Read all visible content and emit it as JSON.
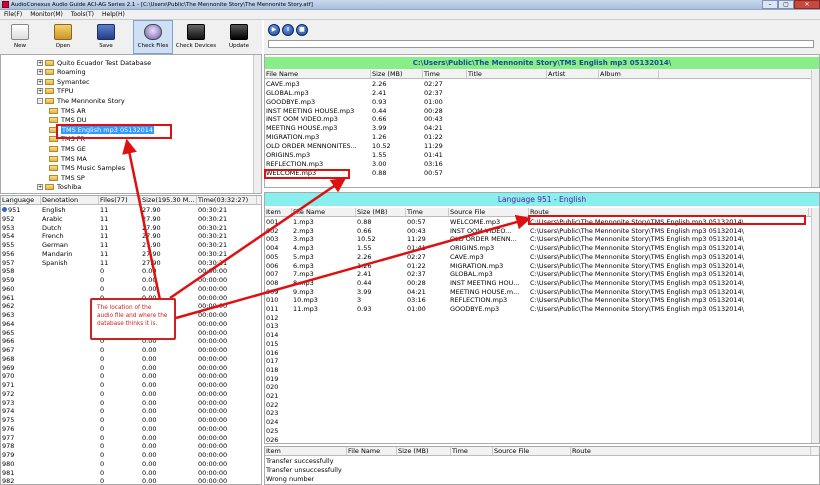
{
  "window": {
    "title": "AudioConexus Audio Guide ACI-AG Series 2.1 - [C:\\Users\\Public\\The Mennonite Story\\The Mennonite Story.atf]",
    "buttons": [
      "–",
      "▢",
      "✕"
    ]
  },
  "menu": [
    "File(F)",
    "Monitor(M)",
    "Tools(T)",
    "Help(H)"
  ],
  "toolbar": {
    "new": "New",
    "open": "Open",
    "save": "Save",
    "check_files": "Check Files",
    "check_devices": "Check Devices",
    "update": "Update"
  },
  "player": {
    "play": "▶",
    "pause": "II",
    "stop": "■"
  },
  "tree": {
    "nodes": [
      {
        "label": "Quito Ecuador Test Database",
        "exp": "+"
      },
      {
        "label": "Roaming",
        "exp": "+"
      },
      {
        "label": "Symantec",
        "exp": "+"
      },
      {
        "label": "TFPU",
        "exp": "+"
      },
      {
        "label": "The Mennonite Story",
        "exp": "-"
      },
      {
        "label": "TMS AR",
        "exp": ""
      },
      {
        "label": "TMS DU",
        "exp": ""
      },
      {
        "label": "TMS English mp3 05132014",
        "exp": ""
      },
      {
        "label": "TMS FR",
        "exp": ""
      },
      {
        "label": "TMS GE",
        "exp": ""
      },
      {
        "label": "TMS MA",
        "exp": ""
      },
      {
        "label": "TMS Music Samples",
        "exp": ""
      },
      {
        "label": "TMS SP",
        "exp": ""
      },
      {
        "label": "Toshiba",
        "exp": "+"
      }
    ]
  },
  "language_table": {
    "headers": [
      "Language",
      "Denotation",
      "Files(77)",
      "Size(195.30 M...",
      "Time(03:32:27)"
    ],
    "rows": [
      [
        "951",
        "English",
        "11",
        "27.90",
        "00:30:21"
      ],
      [
        "952",
        "Arabic",
        "11",
        "27.90",
        "00:30:21"
      ],
      [
        "953",
        "Dutch",
        "11",
        "27.90",
        "00:30:21"
      ],
      [
        "954",
        "French",
        "11",
        "27.90",
        "00:30:21"
      ],
      [
        "955",
        "German",
        "11",
        "27.90",
        "00:30:21"
      ],
      [
        "956",
        "Mandarin",
        "11",
        "27.90",
        "00:30:21"
      ],
      [
        "957",
        "Spanish",
        "11",
        "27.90",
        "00:30:21"
      ],
      [
        "958",
        "",
        "0",
        "0.00",
        "00:00:00"
      ],
      [
        "959",
        "",
        "0",
        "0.00",
        "00:00:00"
      ],
      [
        "960",
        "",
        "0",
        "0.00",
        "00:00:00"
      ],
      [
        "961",
        "",
        "0",
        "0.00",
        "00:00:00"
      ],
      [
        "962",
        "",
        "0",
        "0.00",
        "00:00:00"
      ],
      [
        "963",
        "",
        "0",
        "0.00",
        "00:00:00"
      ],
      [
        "964",
        "",
        "0",
        "0.00",
        "00:00:00"
      ],
      [
        "965",
        "",
        "0",
        "0.00",
        "00:00:00"
      ],
      [
        "966",
        "",
        "0",
        "0.00",
        "00:00:00"
      ],
      [
        "967",
        "",
        "0",
        "0.00",
        "00:00:00"
      ],
      [
        "968",
        "",
        "0",
        "0.00",
        "00:00:00"
      ],
      [
        "969",
        "",
        "0",
        "0.00",
        "00:00:00"
      ],
      [
        "970",
        "",
        "0",
        "0.00",
        "00:00:00"
      ],
      [
        "971",
        "",
        "0",
        "0.00",
        "00:00:00"
      ],
      [
        "972",
        "",
        "0",
        "0.00",
        "00:00:00"
      ],
      [
        "973",
        "",
        "0",
        "0.00",
        "00:00:00"
      ],
      [
        "974",
        "",
        "0",
        "0.00",
        "00:00:00"
      ],
      [
        "975",
        "",
        "0",
        "0.00",
        "00:00:00"
      ],
      [
        "976",
        "",
        "0",
        "0.00",
        "00:00:00"
      ],
      [
        "977",
        "",
        "0",
        "0.00",
        "00:00:00"
      ],
      [
        "978",
        "",
        "0",
        "0.00",
        "00:00:00"
      ],
      [
        "979",
        "",
        "0",
        "0.00",
        "00:00:00"
      ],
      [
        "980",
        "",
        "0",
        "0.00",
        "00:00:00"
      ],
      [
        "981",
        "",
        "0",
        "0.00",
        "00:00:00"
      ],
      [
        "982",
        "",
        "0",
        "0.00",
        "00:00:00"
      ]
    ]
  },
  "file_pane": {
    "path": "C:\\Users\\Public\\The Mennonite Story\\TMS English mp3 05132014\\",
    "headers": [
      "File Name",
      "Size (MB)",
      "Time",
      "Title",
      "Artist",
      "Album"
    ],
    "rows": [
      [
        "CAVE.mp3",
        "2.26",
        "02:27"
      ],
      [
        "GLOBAL.mp3",
        "2.41",
        "02:37"
      ],
      [
        "GOODBYE.mp3",
        "0.93",
        "01:00"
      ],
      [
        "INST MEETING HOUSE.mp3",
        "0.44",
        "00:28"
      ],
      [
        "INST OOM VIDEO.mp3",
        "0.66",
        "00:43"
      ],
      [
        "MEETING HOUSE.mp3",
        "3.99",
        "04:21"
      ],
      [
        "MIGRATION.mp3",
        "1.26",
        "01:22"
      ],
      [
        "OLD ORDER MENNONITES...",
        "10.52",
        "11:29"
      ],
      [
        "ORIGINS.mp3",
        "1.55",
        "01:41"
      ],
      [
        "REFLECTION.mp3",
        "3.00",
        "03:16"
      ],
      [
        "WELCOME.mp3",
        "0.88",
        "00:57"
      ]
    ]
  },
  "route_pane": {
    "title": "Language 951 - English",
    "headers": [
      "Item",
      "File Name",
      "Size (MB)",
      "Time",
      "Source File",
      "Route"
    ],
    "route_value": "C:\\Users\\Public\\The Mennonite Story\\TMS English mp3 05132014\\",
    "rows": [
      [
        "001",
        "1.mp3",
        "0.88",
        "00:57",
        "WELCOME.mp3"
      ],
      [
        "002",
        "2.mp3",
        "0.66",
        "00:43",
        "INST OOM VIDEO..."
      ],
      [
        "003",
        "3.mp3",
        "10.52",
        "11:29",
        "OLD ORDER MENN..."
      ],
      [
        "004",
        "4.mp3",
        "1.55",
        "01:41",
        "ORIGINS.mp3"
      ],
      [
        "005",
        "5.mp3",
        "2.26",
        "02:27",
        "CAVE.mp3"
      ],
      [
        "006",
        "6.mp3",
        "1.26",
        "01:22",
        "MIGRATION.mp3"
      ],
      [
        "007",
        "7.mp3",
        "2.41",
        "02:37",
        "GLOBAL.mp3"
      ],
      [
        "008",
        "8.mp3",
        "0.44",
        "00:28",
        "INST MEETING HOU..."
      ],
      [
        "009",
        "9.mp3",
        "3.99",
        "04:21",
        "MEETING HOUSE.m..."
      ],
      [
        "010",
        "10.mp3",
        "3",
        "03:16",
        "REFLECTION.mp3"
      ],
      [
        "011",
        "11.mp3",
        "0.93",
        "01:00",
        "GOODBYE.mp3"
      ]
    ],
    "empty_items": [
      "012",
      "013",
      "014",
      "015",
      "016",
      "017",
      "018",
      "019",
      "020",
      "021",
      "022",
      "023",
      "024",
      "025",
      "026",
      "027"
    ]
  },
  "log_pane": {
    "headers": [
      "Item",
      "File Name",
      "Size (MB)",
      "Time",
      "Source File",
      "Route"
    ],
    "lines": [
      "Transfer successfully",
      "Transfer unsuccessfully",
      "Wrong number"
    ]
  },
  "annotation": {
    "text": "The location of the audio file and where the database thinks it is.",
    "color": "#cc2222"
  }
}
